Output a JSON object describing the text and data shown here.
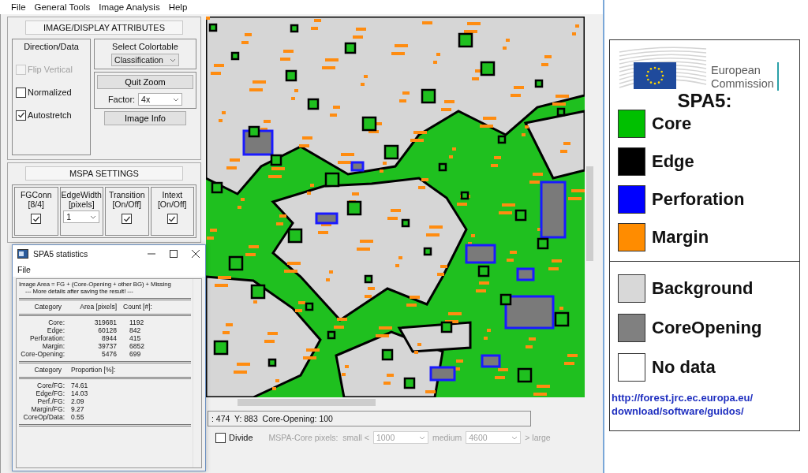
{
  "menu": [
    "File",
    "General Tools",
    "Image Analysis",
    "Help"
  ],
  "display": {
    "title": "IMAGE/DISPLAY ATTRIBUTES",
    "direction": {
      "title": "Direction/Data",
      "options": [
        {
          "label": "Flip Vertical",
          "checked": false,
          "disabled": true
        },
        {
          "label": "Normalized",
          "checked": false,
          "disabled": false
        },
        {
          "label": "Autostretch",
          "checked": true,
          "disabled": false
        }
      ]
    },
    "colortable": {
      "label": "Select Colortable",
      "value": "Classification"
    },
    "quit_zoom": "Quit Zoom",
    "factor": {
      "label": "Factor:",
      "value": "4x"
    },
    "image_info": "Image Info"
  },
  "mspa": {
    "title": "MSPA SETTINGS",
    "settings": [
      {
        "kind": "checkbox",
        "label": "FGConn",
        "sub": "[8/4]",
        "checked": true
      },
      {
        "kind": "dropdown",
        "label": "EdgeWidth",
        "sub": "[pixels]",
        "value": "1"
      },
      {
        "kind": "checkbox",
        "label": "Transition",
        "sub": "[On/Off]",
        "checked": true
      },
      {
        "kind": "checkbox",
        "label": "Intext",
        "sub": "[On/Off]",
        "checked": true
      }
    ]
  },
  "status": ": 474  Y: 883  Core-Opening: 100",
  "divide": {
    "label": "Divide",
    "checked": false
  },
  "core_pixels": {
    "label": "MSPA-Core pixels:  small <",
    "small": "1000",
    "medium_label": "medium",
    "medium": "4600",
    "large_label": "> large",
    "disabled": true
  },
  "stats_window": {
    "title": "SPA5 statistics",
    "menu": [
      "File"
    ],
    "notes": [
      "Image Area = FG + (Core-Opening + other BG) + Missing",
      "--- More details after saving the result! ---"
    ],
    "area_table": {
      "columns": [
        "Category",
        "Area [pixels]",
        "Count [#]:"
      ],
      "rows": [
        {
          "label": "Core:",
          "area": "319681",
          "count": "1192"
        },
        {
          "label": "Edge:",
          "area": "60128",
          "count": "842"
        },
        {
          "label": "Perforation:",
          "area": "8944",
          "count": "415"
        },
        {
          "label": "Margin:",
          "area": "39737",
          "count": "6852"
        },
        {
          "label": "Core-Opening:",
          "area": "5476",
          "count": "699"
        }
      ]
    },
    "proportion_table": {
      "columns": [
        "Category",
        "Proportion [%]:"
      ],
      "rows": [
        {
          "label": "Core/FG:",
          "value": "74.61"
        },
        {
          "label": "Edge/FG:",
          "value": "14.03"
        },
        {
          "label": "Perf./FG:",
          "value": "2.09"
        },
        {
          "label": "Margin/FG:",
          "value": "9.27"
        },
        {
          "label": "CoreOp/Data:",
          "value": "0.55"
        }
      ]
    }
  },
  "legend": {
    "logo": [
      "European",
      "Commission"
    ],
    "title": "SPA5:",
    "groups": [
      [
        {
          "label": "Core",
          "color": "#00c000"
        },
        {
          "label": "Edge",
          "color": "#000000"
        },
        {
          "label": "Perforation",
          "color": "#0000ff"
        },
        {
          "label": "Margin",
          "color": "#ff8c00"
        }
      ],
      [
        {
          "label": "Background",
          "color": "#d8d8d8"
        },
        {
          "label": "CoreOpening",
          "color": "#808080"
        },
        {
          "label": "No data",
          "color": "#ffffff"
        }
      ]
    ],
    "link": [
      "http://forest.jrc.ec.europa.eu/",
      "download/software/guidos/"
    ]
  }
}
